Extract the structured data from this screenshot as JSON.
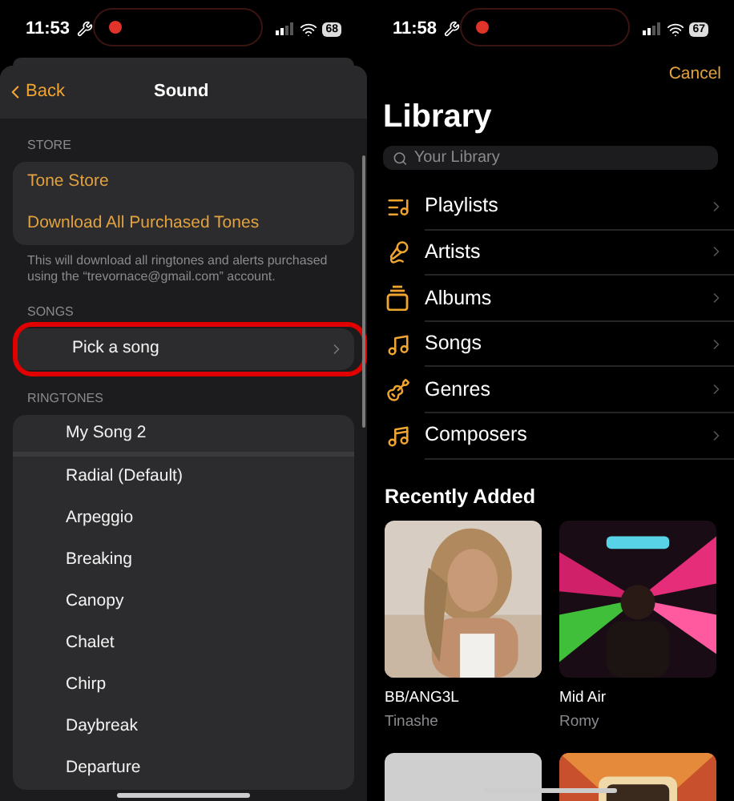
{
  "left": {
    "status_bar": {
      "time": "11:53",
      "battery": "68"
    },
    "nav": {
      "back": "Back",
      "title": "Sound"
    },
    "sections": [
      {
        "header": "STORE",
        "kind": "store",
        "rows": [
          {
            "label": "Tone Store",
            "highlighted": false
          },
          {
            "label": "Download All Purchased Tones",
            "highlighted": false
          }
        ],
        "footer": "This will download all ringtones and alerts purchased using the “trevornace@gmail.com” account."
      },
      {
        "header": "SONGS",
        "kind": "songs",
        "rows": [
          {
            "label": "Pick a song",
            "highlighted": true
          }
        ]
      },
      {
        "header": "RINGTONES",
        "kind": "ringtones",
        "rows": [
          {
            "label": "My Song 2",
            "highlighted": false
          },
          {
            "label": "Radial (Default)",
            "highlighted": false
          },
          {
            "label": "Arpeggio",
            "highlighted": false
          },
          {
            "label": "Breaking",
            "highlighted": false
          },
          {
            "label": "Canopy",
            "highlighted": false
          },
          {
            "label": "Chalet",
            "highlighted": false
          },
          {
            "label": "Chirp",
            "highlighted": false
          },
          {
            "label": "Daybreak",
            "highlighted": false
          },
          {
            "label": "Departure",
            "highlighted": false
          }
        ]
      }
    ]
  },
  "right": {
    "status_bar": {
      "time": "11:58",
      "battery": "67"
    },
    "cancel": "Cancel",
    "title": "Library",
    "search": {
      "placeholder": "Your Library"
    },
    "items": [
      {
        "label": "Playlists",
        "kind": "playlists"
      },
      {
        "label": "Artists",
        "kind": "artists"
      },
      {
        "label": "Albums",
        "kind": "albums"
      },
      {
        "label": "Songs",
        "kind": "songs"
      },
      {
        "label": "Genres",
        "kind": "genres"
      },
      {
        "label": "Composers",
        "kind": "composers"
      }
    ],
    "recently_added": {
      "title": "Recently Added",
      "albums": [
        {
          "kind": "picture",
          "title": "BB/ANG3L",
          "artist": "Tinashe"
        },
        {
          "kind": "picture",
          "title": "Mid Air",
          "artist": "Romy"
        },
        {
          "kind": "picture"
        },
        {
          "kind": "picture"
        }
      ]
    }
  }
}
